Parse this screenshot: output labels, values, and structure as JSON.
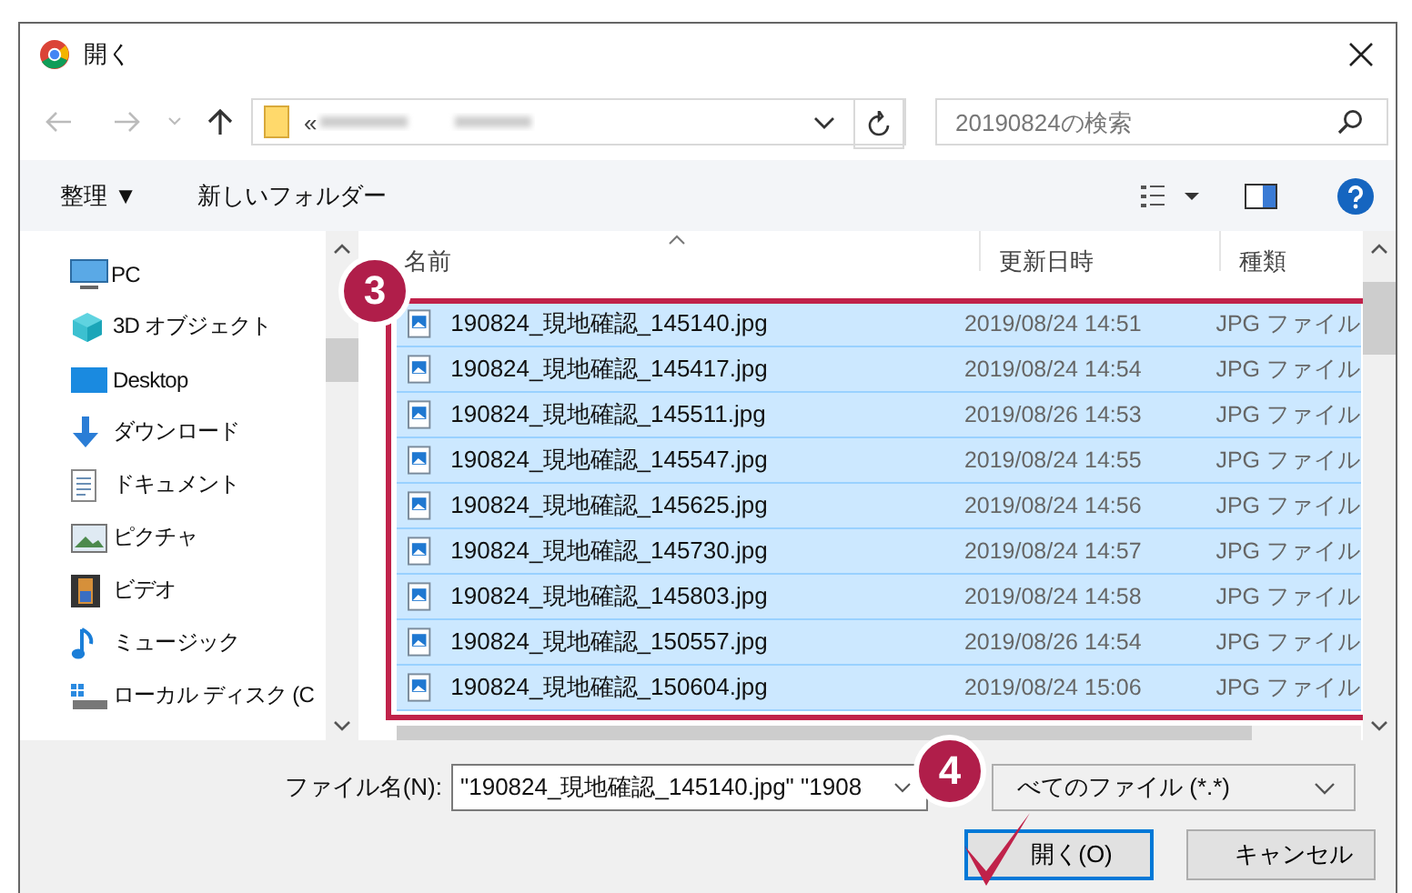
{
  "window": {
    "title": "開く"
  },
  "address_bar": {
    "prefix": "«"
  },
  "search": {
    "placeholder": "20190824の検索"
  },
  "toolbar": {
    "organize": "整理 ▼",
    "new_folder": "新しいフォルダー"
  },
  "nav_tree": [
    {
      "label": "PC",
      "kind": "pc",
      "children": [
        {
          "label": "3D オブジェクト",
          "kind": "objects"
        },
        {
          "label": "Desktop",
          "kind": "desktop"
        },
        {
          "label": "ダウンロード",
          "kind": "downloads"
        },
        {
          "label": "ドキュメント",
          "kind": "documents"
        },
        {
          "label": "ピクチャ",
          "kind": "pictures"
        },
        {
          "label": "ビデオ",
          "kind": "videos"
        },
        {
          "label": "ミュージック",
          "kind": "music"
        },
        {
          "label": "ローカル ディスク (C",
          "kind": "drive"
        }
      ]
    }
  ],
  "table": {
    "columns": [
      "名前",
      "更新日時",
      "種類"
    ],
    "rows": [
      {
        "name": "190824_現地確認_145140.jpg",
        "date": "2019/08/24 14:51",
        "type": "JPG ファイル",
        "selected": true
      },
      {
        "name": "190824_現地確認_145417.jpg",
        "date": "2019/08/24 14:54",
        "type": "JPG ファイル",
        "selected": true
      },
      {
        "name": "190824_現地確認_145511.jpg",
        "date": "2019/08/26 14:53",
        "type": "JPG ファイル",
        "selected": true
      },
      {
        "name": "190824_現地確認_145547.jpg",
        "date": "2019/08/24 14:55",
        "type": "JPG ファイル",
        "selected": true
      },
      {
        "name": "190824_現地確認_145625.jpg",
        "date": "2019/08/24 14:56",
        "type": "JPG ファイル",
        "selected": true
      },
      {
        "name": "190824_現地確認_145730.jpg",
        "date": "2019/08/24 14:57",
        "type": "JPG ファイル",
        "selected": true
      },
      {
        "name": "190824_現地確認_145803.jpg",
        "date": "2019/08/24 14:58",
        "type": "JPG ファイル",
        "selected": true
      },
      {
        "name": "190824_現地確認_150557.jpg",
        "date": "2019/08/26 14:54",
        "type": "JPG ファイル",
        "selected": true
      },
      {
        "name": "190824_現地確認_150604.jpg",
        "date": "2019/08/24 15:06",
        "type": "JPG ファイル",
        "selected": true
      }
    ]
  },
  "filename": {
    "label": "ファイル名(N):",
    "value": "\"190824_現地確認_145140.jpg\" \"1908"
  },
  "filetype": {
    "value": "べてのファイル (*.*)"
  },
  "buttons": [
    {
      "label": "開く(O)",
      "kind": "primary"
    },
    {
      "label": "キャンセル",
      "kind": "normal"
    }
  ],
  "step_badges": [
    {
      "number": "3"
    },
    {
      "number": "4"
    }
  ]
}
